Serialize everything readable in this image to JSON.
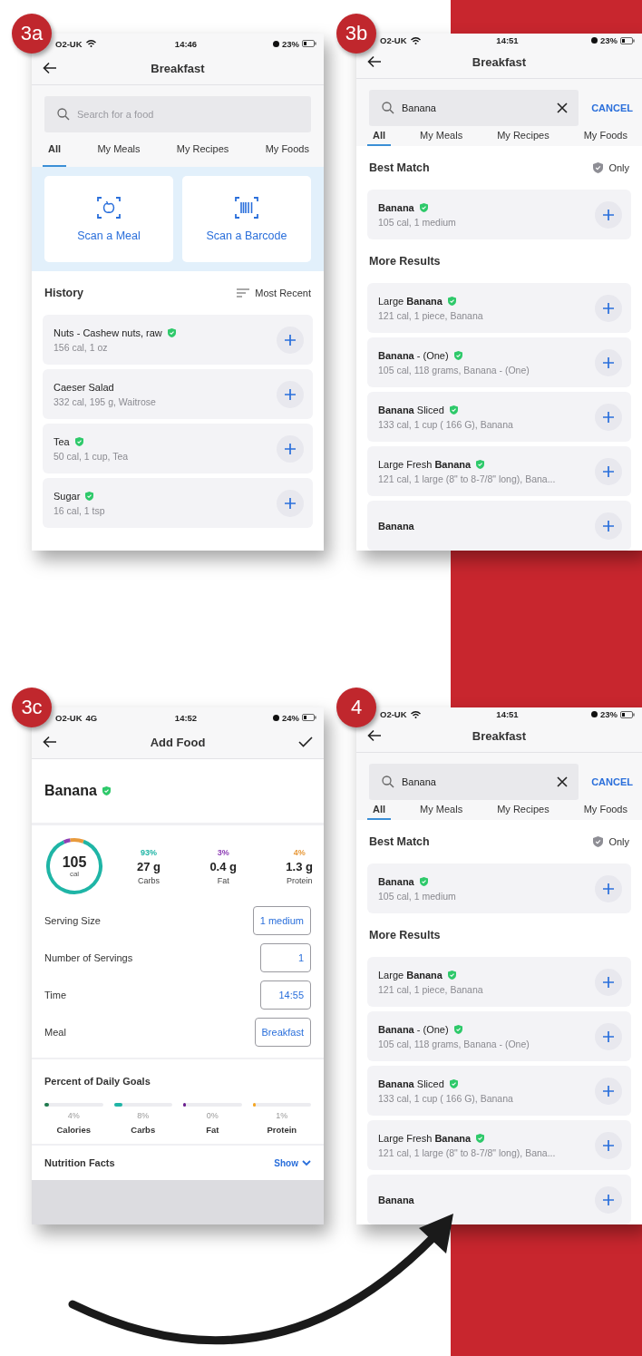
{
  "screens": [
    {
      "kind": "home",
      "badge": "3a",
      "status_bar": {
        "carrier": "O2-UK",
        "time": "14:46",
        "battery": "23%"
      },
      "title": "Breakfast",
      "search": {
        "placeholder": "Search for a food"
      },
      "tabs": [
        {
          "label": "All",
          "selected": true
        },
        {
          "label": "My Meals",
          "selected": false
        },
        {
          "label": "My Recipes",
          "selected": false
        },
        {
          "label": "My Foods",
          "selected": false
        }
      ],
      "scan_cards": [
        {
          "kind": "meal",
          "label": "Scan a Meal"
        },
        {
          "kind": "barcode",
          "label": "Scan a Barcode"
        }
      ],
      "history": {
        "title": "History",
        "sort": "Most Recent",
        "items": [
          {
            "name": "Nuts - Cashew nuts, raw",
            "detail": "156 cal, 1 oz",
            "verified": true
          },
          {
            "name": "Caeser Salad",
            "detail": "332 cal, 195 g, Waitrose",
            "verified": false
          },
          {
            "name": "Tea",
            "detail": "50 cal, 1 cup, Tea",
            "verified": true
          },
          {
            "name": "Sugar",
            "detail": "16 cal, 1 tsp",
            "verified": true
          }
        ]
      }
    },
    {
      "kind": "results",
      "badge": "3b",
      "status_bar": {
        "carrier": "O2-UK",
        "time": "14:51",
        "battery": "23%"
      },
      "title": "Breakfast",
      "search": {
        "value": "Banana",
        "cancel": "CANCEL"
      },
      "tabs": [
        {
          "label": "All",
          "selected": true
        },
        {
          "label": "My Meals",
          "selected": false
        },
        {
          "label": "My Recipes",
          "selected": false
        },
        {
          "label": "My Foods",
          "selected": false
        }
      ],
      "best_match": {
        "title": "Best Match",
        "filter": "Only",
        "items": [
          {
            "name": "Banana",
            "bold": true,
            "detail": "105 cal, 1 medium",
            "verified": true
          }
        ]
      },
      "more_results": {
        "title": "More Results",
        "items": [
          {
            "name": "Large **Banana**",
            "bold": false,
            "detail": "121 cal, 1 piece, Banana",
            "verified": true
          },
          {
            "name": "**Banana** - (One)",
            "bold": false,
            "detail": "105 cal, 118 grams, Banana - (One)",
            "verified": true
          },
          {
            "name": "**Banana** Sliced",
            "bold": false,
            "detail": "133 cal, 1 cup ( 166 G), Banana",
            "verified": true
          },
          {
            "name": "Large Fresh **Banana**",
            "bold": false,
            "detail": "121 cal, 1 large (8\" to 8-7/8\" long), Bana...",
            "verified": true
          },
          {
            "name": "Banana",
            "bold": true,
            "verified": false
          }
        ]
      }
    },
    {
      "kind": "add_food",
      "badge": "3c",
      "status_bar": {
        "carrier": "O2-UK",
        "network": "4G",
        "time": "14:52",
        "battery": "24%"
      },
      "title": "Add Food",
      "food": {
        "name": "Banana",
        "verified": true
      },
      "calories": {
        "value": "105",
        "unit": "cal"
      },
      "macros": [
        {
          "percent": "93%",
          "amount": "27 g",
          "label": "Carbs",
          "color": "#1fb5a6"
        },
        {
          "percent": "3%",
          "amount": "0.4 g",
          "label": "Fat",
          "color": "#8e3fb5"
        },
        {
          "percent": "4%",
          "amount": "1.3 g",
          "label": "Protein",
          "color": "#e89a3c"
        }
      ],
      "fields": [
        {
          "label": "Serving Size",
          "value": "1 medium"
        },
        {
          "label": "Number of Servings",
          "value": "1"
        },
        {
          "label": "Time",
          "value": "14:55"
        },
        {
          "label": "Meal",
          "value": "Breakfast"
        }
      ],
      "goals": {
        "title": "Percent of Daily Goals",
        "items": [
          {
            "percent": "4%",
            "label": "Calories",
            "level": 0.08,
            "color": "#1f7a4d"
          },
          {
            "percent": "8%",
            "label": "Carbs",
            "level": 0.15,
            "color": "#1fb5a6"
          },
          {
            "percent": "0%",
            "label": "Fat",
            "level": 0.05,
            "color": "#6b1f8f"
          },
          {
            "percent": "1%",
            "label": "Protein",
            "level": 0.05,
            "color": "#f5a623"
          }
        ]
      },
      "nutrition": {
        "title": "Nutrition Facts",
        "action": "Show"
      }
    },
    {
      "kind": "results",
      "badge": "4",
      "status_bar": {
        "carrier": "O2-UK",
        "time": "14:51",
        "battery": "23%"
      },
      "title": "Breakfast",
      "search": {
        "value": "Banana",
        "cancel": "CANCEL"
      },
      "tabs": [
        {
          "label": "All",
          "selected": true
        },
        {
          "label": "My Meals",
          "selected": false
        },
        {
          "label": "My Recipes",
          "selected": false
        },
        {
          "label": "My Foods",
          "selected": false
        }
      ],
      "best_match": {
        "title": "Best Match",
        "filter": "Only",
        "items": [
          {
            "name": "Banana",
            "bold": true,
            "detail": "105 cal, 1 medium",
            "verified": true
          }
        ]
      },
      "more_results": {
        "title": "More Results",
        "items": [
          {
            "name": "Large **Banana**",
            "bold": false,
            "detail": "121 cal, 1 piece, Banana",
            "verified": true
          },
          {
            "name": "**Banana** - (One)",
            "bold": false,
            "detail": "105 cal, 118 grams, Banana - (One)",
            "verified": true
          },
          {
            "name": "**Banana** Sliced",
            "bold": false,
            "detail": "133 cal, 1 cup ( 166 G), Banana",
            "verified": true
          },
          {
            "name": "Large Fresh **Banana**",
            "bold": false,
            "detail": "121 cal, 1 large (8\" to 8-7/8\" long), Bana...",
            "verified": true
          },
          {
            "name": "Banana",
            "bold": true,
            "verified": false
          }
        ]
      }
    }
  ]
}
